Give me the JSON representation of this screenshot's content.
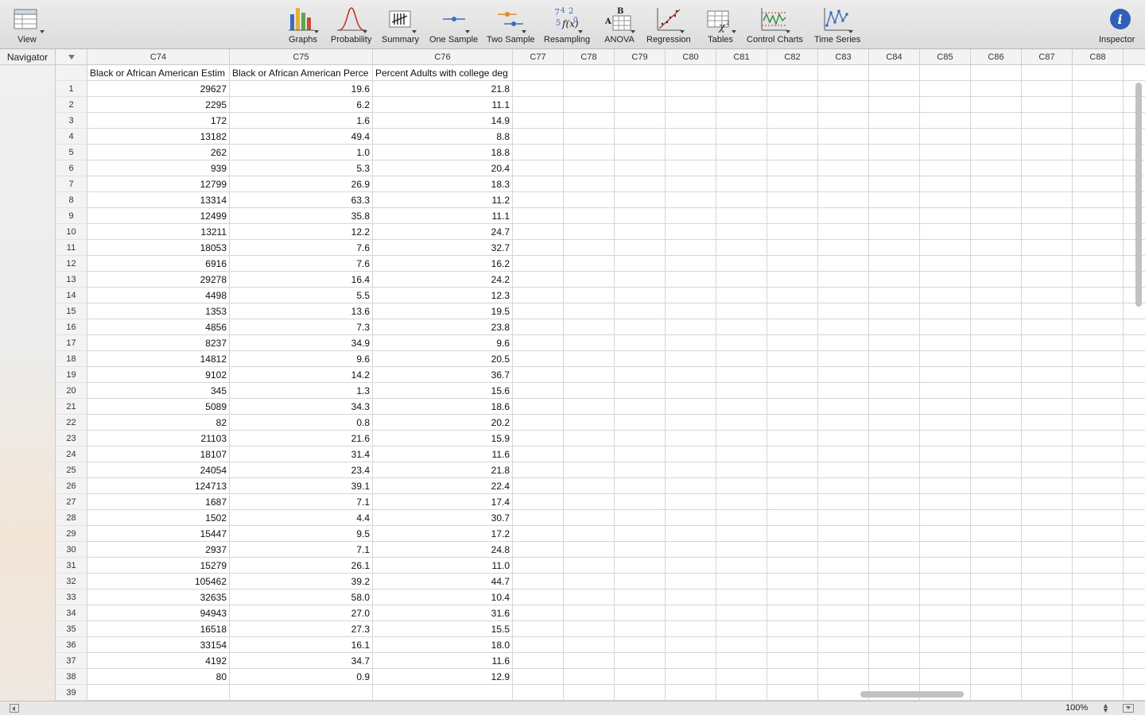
{
  "toolbar": {
    "view_label": "View",
    "graphs_label": "Graphs",
    "probability_label": "Probability",
    "summary_label": "Summary",
    "one_sample_label": "One Sample",
    "two_sample_label": "Two Sample",
    "resampling_label": "Resampling",
    "anova_label": "ANOVA",
    "regression_label": "Regression",
    "tables_label": "Tables",
    "control_charts_label": "Control Charts",
    "time_series_label": "Time Series",
    "inspector_label": "Inspector"
  },
  "navigator": {
    "label": "Navigator"
  },
  "grid": {
    "columns": [
      "C74",
      "C75",
      "C76",
      "C77",
      "C78",
      "C79",
      "C80",
      "C81",
      "C82",
      "C83",
      "C84",
      "C85",
      "C86",
      "C87",
      "C88",
      "C"
    ],
    "column_names": [
      "Black or African American Estim",
      "Black or African American Perce",
      "Percent Adults with college deg"
    ],
    "rows": [
      [
        "29627",
        "19.6",
        "21.8"
      ],
      [
        "2295",
        "6.2",
        "11.1"
      ],
      [
        "172",
        "1.6",
        "14.9"
      ],
      [
        "13182",
        "49.4",
        "8.8"
      ],
      [
        "262",
        "1.0",
        "18.8"
      ],
      [
        "939",
        "5.3",
        "20.4"
      ],
      [
        "12799",
        "26.9",
        "18.3"
      ],
      [
        "13314",
        "63.3",
        "11.2"
      ],
      [
        "12499",
        "35.8",
        "11.1"
      ],
      [
        "13211",
        "12.2",
        "24.7"
      ],
      [
        "18053",
        "7.6",
        "32.7"
      ],
      [
        "6916",
        "7.6",
        "16.2"
      ],
      [
        "29278",
        "16.4",
        "24.2"
      ],
      [
        "4498",
        "5.5",
        "12.3"
      ],
      [
        "1353",
        "13.6",
        "19.5"
      ],
      [
        "4856",
        "7.3",
        "23.8"
      ],
      [
        "8237",
        "34.9",
        "9.6"
      ],
      [
        "14812",
        "9.6",
        "20.5"
      ],
      [
        "9102",
        "14.2",
        "36.7"
      ],
      [
        "345",
        "1.3",
        "15.6"
      ],
      [
        "5089",
        "34.3",
        "18.6"
      ],
      [
        "82",
        "0.8",
        "20.2"
      ],
      [
        "21103",
        "21.6",
        "15.9"
      ],
      [
        "18107",
        "31.4",
        "11.6"
      ],
      [
        "24054",
        "23.4",
        "21.8"
      ],
      [
        "124713",
        "39.1",
        "22.4"
      ],
      [
        "1687",
        "7.1",
        "17.4"
      ],
      [
        "1502",
        "4.4",
        "30.7"
      ],
      [
        "15447",
        "9.5",
        "17.2"
      ],
      [
        "2937",
        "7.1",
        "24.8"
      ],
      [
        "15279",
        "26.1",
        "11.0"
      ],
      [
        "105462",
        "39.2",
        "44.7"
      ],
      [
        "32635",
        "58.0",
        "10.4"
      ],
      [
        "94943",
        "27.0",
        "31.6"
      ],
      [
        "16518",
        "27.3",
        "15.5"
      ],
      [
        "33154",
        "16.1",
        "18.0"
      ],
      [
        "4192",
        "34.7",
        "11.6"
      ],
      [
        "80",
        "0.9",
        "12.9"
      ],
      [
        "",
        "",
        ""
      ]
    ]
  },
  "status": {
    "zoom": "100%"
  }
}
